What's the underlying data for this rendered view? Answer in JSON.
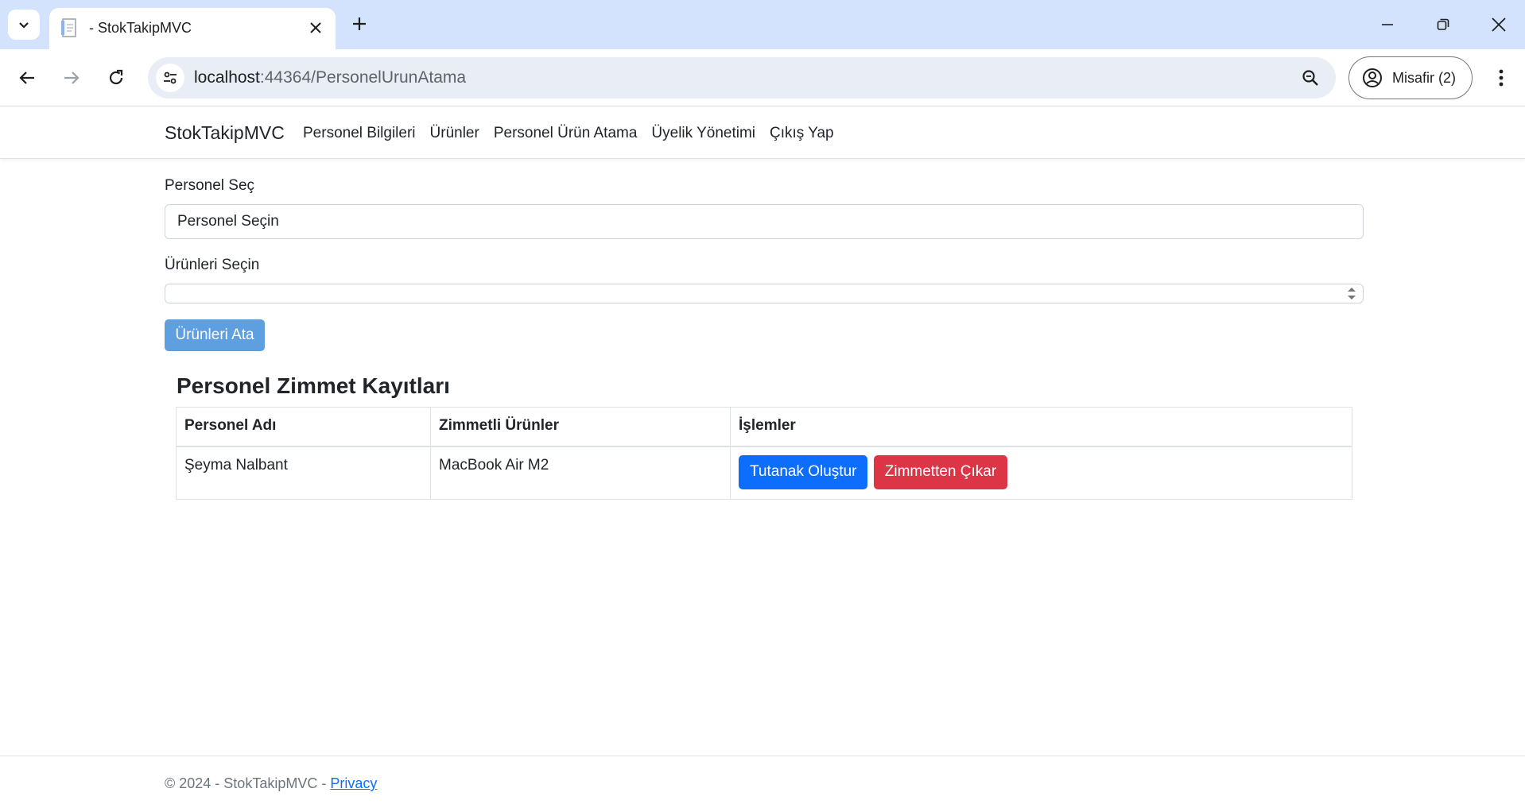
{
  "browser": {
    "tab_title": "- StokTakipMVC",
    "url_host": "localhost",
    "url_path": ":44364/PersonelUrunAtama",
    "profile_label": "Misafir (2)"
  },
  "navbar": {
    "brand": "StokTakipMVC",
    "links": [
      {
        "label": "Personel Bilgileri"
      },
      {
        "label": "Ürünler"
      },
      {
        "label": "Personel Ürün Atama"
      },
      {
        "label": "Üyelik Yönetimi"
      },
      {
        "label": "Çıkış Yap"
      }
    ]
  },
  "form": {
    "personel_label": "Personel Seç",
    "personel_selected": "Personel Seçin",
    "urunler_label": "Ürünleri Seçin",
    "submit_label": "Ürünleri Ata"
  },
  "records": {
    "title": "Personel Zimmet Kayıtları",
    "columns": [
      "Personel Adı",
      "Zimmetli Ürünler",
      "İşlemler"
    ],
    "rows": [
      {
        "personel": "Şeyma Nalbant",
        "urunler": "MacBook Air M2",
        "actions": {
          "tutanak": "Tutanak Oluştur",
          "cikar": "Zimmetten Çıkar"
        }
      }
    ]
  },
  "footer": {
    "text": "© 2024 - StokTakipMVC - ",
    "privacy": "Privacy"
  },
  "colors": {
    "primary": "#0d6efd",
    "danger": "#dc3545",
    "assign_button": "#5e9fe0",
    "tabstrip": "#d3e3fd"
  }
}
